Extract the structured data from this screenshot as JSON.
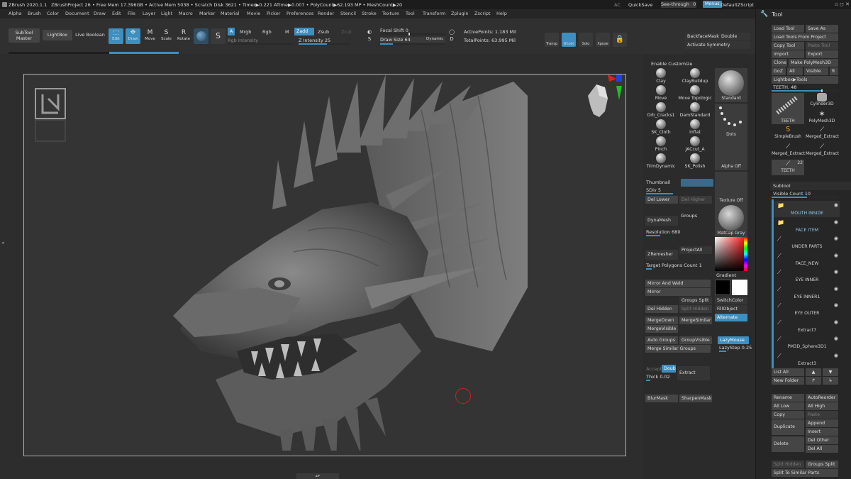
{
  "titlebar": {
    "app": "ZBrush 2020.1.1",
    "project": "ZBrushProject 26",
    "stats": "• Free Mem 17.396GB • Active Mem 5038 • Scratch Disk 3621 • Timer▶0.221 ATime▶0.007 • PolyCount▶62.193 MP • MeshCount▶20",
    "ac": "AC",
    "quicksave": "QuickSave",
    "seethrough": "See-through",
    "seethrough_value": "0",
    "menus": "Menus",
    "script": "DefaultZScript"
  },
  "menubar": [
    "Alpha",
    "Brush",
    "Color",
    "Document",
    "Draw",
    "Edit",
    "File",
    "Layer",
    "Light",
    "Macro",
    "Marker",
    "Material",
    "Movie",
    "Picker",
    "Preferences",
    "Render",
    "Stencil",
    "Stroke",
    "Texture",
    "Tool",
    "Transform",
    "Zplugin",
    "Zscript",
    "Help"
  ],
  "shelf": {
    "subtool_master": "SubTool\nMaster",
    "lightbox": "LightBox",
    "live_boolean": "Live Boolean",
    "edit": "Edit",
    "draw": "Draw",
    "move": "Move",
    "scale": "Scale",
    "rotate": "Rotate",
    "a": "A",
    "mrgb": "Mrgb",
    "rgb": "Rgb",
    "m": "M",
    "zadd": "Zadd",
    "zsub": "Zsub",
    "zcut": "Zcut",
    "rgb_intensity": "Rgb Intensity",
    "z_intensity": "Z Intensity",
    "z_intensity_value": "25",
    "focal_shift": "Focal Shift",
    "focal_shift_value": "0",
    "draw_size": "Draw Size",
    "draw_size_value": "64",
    "dynamic": "Dynamic",
    "active_points": "ActivePoints: 1.183 Mil",
    "total_points": "TotalPoints: 63.995 Mil",
    "transp": "Transp",
    "ghost": "Ghost",
    "solo": "Solo",
    "xpose": "Xpose",
    "backface_mask": "BackfaceMask",
    "double": "Double",
    "activate_symmetry": "Activate Symmetry"
  },
  "mid": {
    "enable_customize": "Enable Customize",
    "brushes": [
      "Clay",
      "ClayBuildup",
      "Move",
      "Move Topologic",
      "Orb_Cracks1",
      "DamStandard",
      "SK_Cloth",
      "Inflat",
      "Pinch",
      "JACcut_A",
      "TrimDynamic",
      "SK_Polish"
    ],
    "standard": "Standard",
    "dots": "Dots",
    "alpha_off": "Alpha Off",
    "texture_off": "Texture Off",
    "matcap": "MatCap Gray",
    "gradient": "Gradient",
    "switchcolor": "SwitchColor",
    "fillobject": "FillObject",
    "alternate": "Alternate",
    "thumbnail": "Thumbnail",
    "sdiv": "SDiv",
    "sdiv_value": "5",
    "del_lower": "Del Lower",
    "del_higher": "Del Higher",
    "dynamesh": "DynaMesh",
    "groups": "Groups",
    "resolution": "Resolution",
    "resolution_value": "680",
    "zremesher": "ZRemesher",
    "projectall": "ProjectAll",
    "target_polys": "Target Polygons Count",
    "target_polys_value": "1",
    "mirror_weld": "Mirror And Weld",
    "mirror": "Mirror",
    "groups_split": "Groups Split",
    "del_hidden": "Del Hidden",
    "split_hidden": "Split Hidden",
    "mergedown": "MergeDown",
    "mergesimilar": "MergeSimilar",
    "mergevisible": "MergeVisible",
    "auto_groups": "Auto Groups",
    "groupvisible": "GroupVisible",
    "merge_similar_groups": "Merge Similar Groups",
    "lazymouse": "LazyMouse",
    "lazystep": "LazyStep",
    "lazystep_value": "0.25",
    "accept": "Accept",
    "double": "Double",
    "extract": "Extract",
    "thick": "Thick",
    "thick_value": "0.02",
    "blurmask": "BlurMask",
    "sharpenmask": "SharpenMask"
  },
  "right": {
    "title": "Tool",
    "load_tool": "Load Tool",
    "save_as": "Save As",
    "load_project": "Load Tools From Project",
    "copy_tool": "Copy Tool",
    "paste_tool": "Paste Tool",
    "import": "Import",
    "export": "Export",
    "clone": "Clone",
    "make_polymesh": "Make PolyMesh3D",
    "goz": "GoZ",
    "all": "All",
    "visible": "Visible",
    "r": "R",
    "lightbox_tools": "Lightbox▶Tools",
    "teeth_slider": "TEETH.",
    "teeth_value": "48",
    "tool_thumbs": [
      "TEETH",
      "Cylinder3D",
      "PolyMesh3D",
      "SimpleBrush",
      "Merged_Extract",
      "Merged_Extract",
      "Merged_Extract",
      "TEETH"
    ],
    "teeth_count": "22",
    "subtool": "Subtool",
    "visible_count": "Visible Count",
    "visible_count_value": "10",
    "subtools": [
      "MOUTH INSIDE",
      "FACE ITEM",
      "UNDER PARTS",
      "FACE_NEW",
      "EYE INNER",
      "EYE INNER1",
      "EYE OUTER",
      "Extract7",
      "PM3D_Sphere3D1",
      "Extract3"
    ],
    "list_all": "List All",
    "new_folder": "New Folder",
    "rename": "Rename",
    "autoreorder": "AutoReorder",
    "all_low": "All Low",
    "all_high": "All High",
    "copy": "Copy",
    "paste": "Paste",
    "duplicate": "Duplicate",
    "append": "Append",
    "insert": "Insert",
    "delete": "Delete",
    "del_other": "Del Other",
    "del_all": "Del All",
    "split_hidden": "Split Hidden",
    "groups_split": "Groups Split",
    "split_similar": "Split To Similar Parts"
  },
  "colors": {
    "accent": "#3d8fc0",
    "bg": "#2b2b2b",
    "canvas": "#343434"
  }
}
